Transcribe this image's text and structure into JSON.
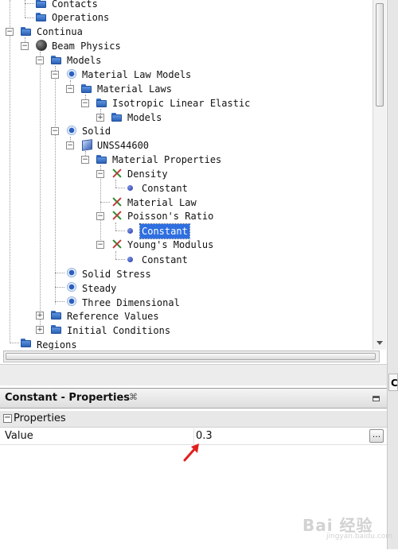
{
  "tree": {
    "contacts": "Contacts",
    "operations": "Operations",
    "continua": "Continua",
    "beam_physics": "Beam Physics",
    "models": "Models",
    "material_law_models": "Material Law Models",
    "material_laws": "Material Laws",
    "isotropic_linear_elastic": "Isotropic Linear Elastic",
    "ile_models": "Models",
    "solid": "Solid",
    "material_name": "UNSS44600",
    "material_properties": "Material Properties",
    "density": "Density",
    "density_constant": "Constant",
    "material_law": "Material Law",
    "poissons_ratio": "Poisson's Ratio",
    "poissons_constant": "Constant",
    "youngs_modulus": "Young's Modulus",
    "youngs_constant": "Constant",
    "solid_stress": "Solid Stress",
    "steady": "Steady",
    "three_dimensional": "Three Dimensional",
    "reference_values": "Reference Values",
    "initial_conditions": "Initial Conditions",
    "regions": "Regions"
  },
  "properties_panel": {
    "title": "Constant - Properties",
    "close_glyph": "⌘",
    "category": "Properties",
    "category_toggle": "−",
    "property_name": "Value",
    "property_value": "0.3",
    "ellipsis_label": "...",
    "right_tab_letter": "C"
  },
  "watermark": {
    "text": "Bai 经验",
    "sub": "jingyan.baidu.com"
  },
  "colors": {
    "selection": "#2f6fe0",
    "annotation_arrow": "#e02020"
  }
}
